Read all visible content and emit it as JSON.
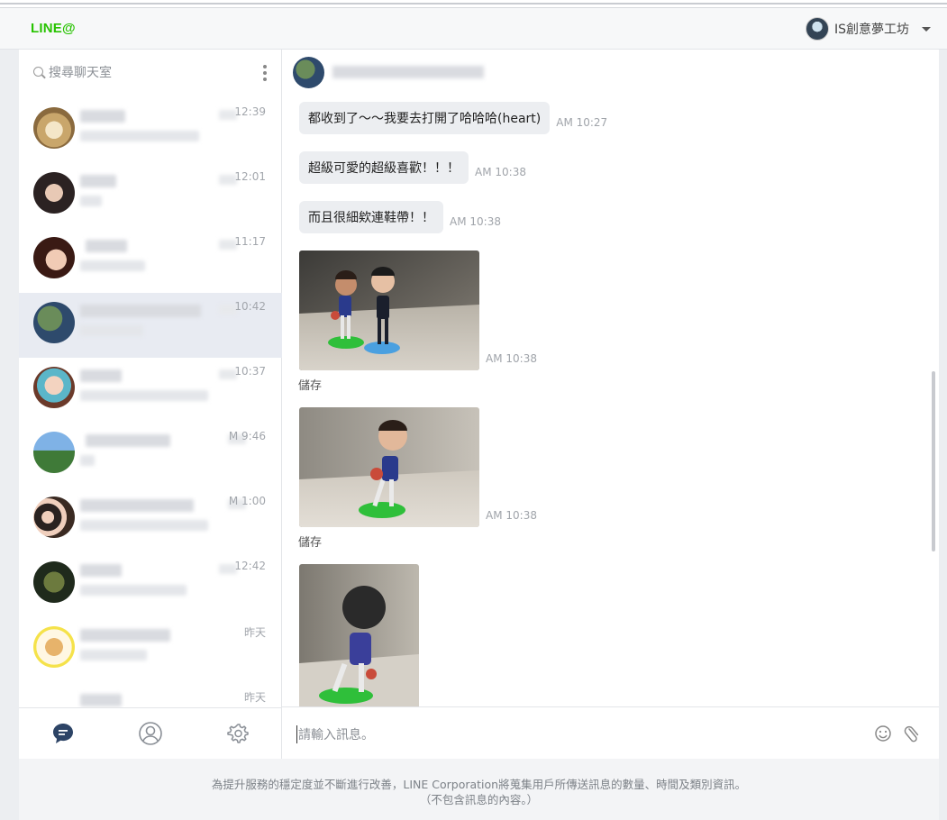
{
  "header": {
    "logo": "LINE@",
    "account_name": "IS創意夢工坊"
  },
  "sidebar": {
    "search_placeholder": "搜尋聊天室",
    "chats": [
      {
        "time": "12:39"
      },
      {
        "time": "12:01"
      },
      {
        "time": "11:17"
      },
      {
        "time": "10:42"
      },
      {
        "time": "10:37"
      },
      {
        "time": "M 9:46"
      },
      {
        "time": "M 1:00"
      },
      {
        "time": "12:42"
      },
      {
        "time": "昨天"
      },
      {
        "time": "昨天"
      }
    ]
  },
  "conversation": {
    "messages": [
      {
        "text": "都收到了～～我要去打開了哈哈哈(heart)",
        "time": "AM 10:27"
      },
      {
        "text": "超級可愛的超級喜歡！！！",
        "time": "AM 10:38"
      },
      {
        "text": "而且很細欸連鞋帶！！",
        "time": "AM 10:38"
      }
    ],
    "images": [
      {
        "time": "AM 10:38",
        "save_label": "儲存"
      },
      {
        "time": "AM 10:38",
        "save_label": "儲存"
      }
    ],
    "input_placeholder": "請輸入訊息。"
  },
  "footer": {
    "line1": "為提升服務的穩定度並不斷進行改善，LINE Corporation將蒐集用戶所傳送訊息的數量、時間及類別資訊。",
    "line2": "（不包含訊息的內容。）"
  },
  "colors": {
    "brand_green": "#27c300",
    "active_row": "#e8ebf2",
    "bubble": "#eceef1"
  }
}
